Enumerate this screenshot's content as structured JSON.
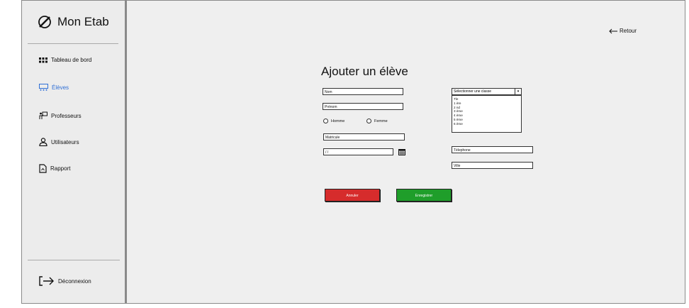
{
  "app": {
    "name": "Mon Etab"
  },
  "sidebar": {
    "items": [
      {
        "label": "Tableau de bord",
        "icon": "dashboard-grid-icon",
        "active": false
      },
      {
        "label": "Élèves",
        "icon": "students-board-icon",
        "active": true
      },
      {
        "label": "Professeurs",
        "icon": "teacher-board-icon",
        "active": false
      },
      {
        "label": "Utilisateurs",
        "icon": "user-icon",
        "active": false
      },
      {
        "label": "Rapport",
        "icon": "report-file-icon",
        "active": false
      }
    ],
    "logout": "Déconnexion"
  },
  "header": {
    "back_label": "Retour"
  },
  "form": {
    "title": "Ajouter un élève",
    "nom": "Nom",
    "prenom": "Prénom",
    "gender": {
      "male": "Homme",
      "female": "Femme"
    },
    "matricule": "Matricule",
    "date": "/ /",
    "classe": {
      "placeholder": "Sélectionner une classe",
      "options": [
        "Tle",
        "1 ère",
        "2 nd",
        "3 ème",
        "4 ème",
        "5 ème",
        "6 ème"
      ]
    },
    "telephone": "Télephone",
    "ville": "Ville",
    "cancel_label": "Annuler",
    "save_label": "Enregistrer"
  },
  "colors": {
    "accent": "#2f6fd6",
    "cancel": "#d62c2c",
    "save": "#1f9e2a",
    "background": "#efefef"
  }
}
